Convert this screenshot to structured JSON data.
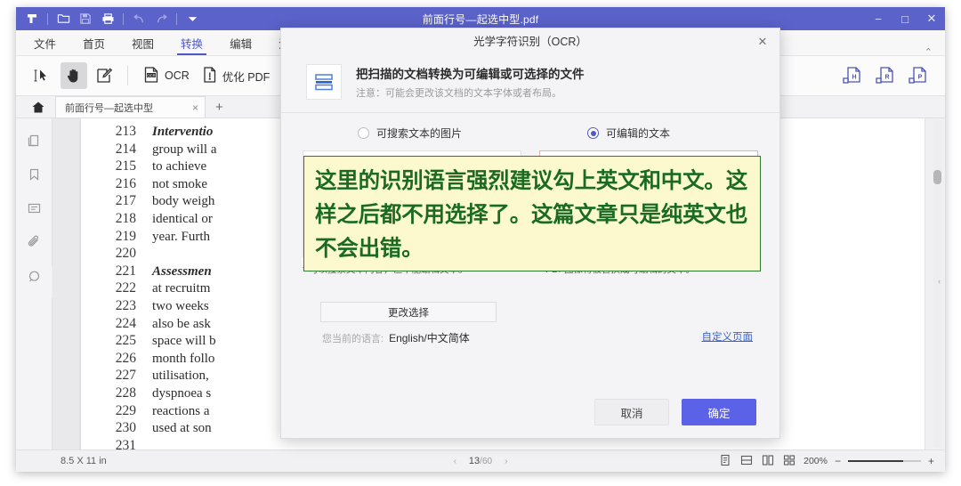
{
  "window": {
    "title": "前面行号—起选中型.pdf",
    "quick_access": [
      {
        "name": "app-logo-icon",
        "label": "F"
      },
      {
        "name": "open-file-icon",
        "label": "open"
      },
      {
        "name": "save-icon",
        "label": "save"
      },
      {
        "name": "print-icon",
        "label": "print"
      },
      {
        "name": "undo-icon",
        "label": "undo"
      },
      {
        "name": "redo-icon",
        "label": "redo"
      },
      {
        "name": "customize-dropdown-icon",
        "label": "more"
      }
    ],
    "controls": {
      "minimize": "−",
      "maximize": "□",
      "close": "✕"
    }
  },
  "menubar": {
    "items": [
      {
        "label": "文件",
        "active": false
      },
      {
        "label": "首页",
        "active": false
      },
      {
        "label": "视图",
        "active": false
      },
      {
        "label": "转换",
        "active": true
      },
      {
        "label": "编辑",
        "active": false
      },
      {
        "label": "注释",
        "active": false
      }
    ]
  },
  "ribbon": {
    "tools": [
      {
        "name": "select-text-tool",
        "label": "",
        "icon": "text-cursor-icon",
        "selected": false
      },
      {
        "name": "hand-tool",
        "label": "",
        "icon": "hand-icon",
        "selected": true
      },
      {
        "name": "edit-tool",
        "label": "",
        "icon": "pencil-page-icon",
        "selected": false
      },
      {
        "name": "ocr-tool",
        "label": "OCR",
        "icon": "ocr-page-icon",
        "selected": false
      },
      {
        "name": "optimize-pdf-tool",
        "label": "优化 PDF",
        "icon": "optimize-page-icon",
        "selected": false
      },
      {
        "name": "to-word-tool",
        "label": "",
        "icon": "pdf-to-word-icon",
        "selected": false
      }
    ],
    "right_tools": [
      {
        "name": "to-html-tool",
        "icon": "pdf-to-html-icon",
        "label": "H"
      },
      {
        "name": "to-rtf-tool",
        "icon": "pdf-to-rtf-icon",
        "label": "R"
      },
      {
        "name": "to-ppt-tool",
        "icon": "pdf-to-ppt-icon",
        "label": "P"
      }
    ],
    "collapse_label": "⌃"
  },
  "tabstrip": {
    "home_icon": "home-icon",
    "tab_label": "前面行号—起选中型",
    "close_label": "×",
    "add_label": "+"
  },
  "left_rail": {
    "items": [
      {
        "name": "page-thumbnails-icon",
        "label": "thumbnails"
      },
      {
        "name": "bookmark-icon",
        "label": "bookmarks"
      },
      {
        "name": "comment-list-icon",
        "label": "comments"
      },
      {
        "name": "attachment-icon",
        "label": "attachments"
      },
      {
        "name": "stamp-icon",
        "label": "stamps"
      }
    ],
    "expander_label": "›"
  },
  "document": {
    "lines": [
      {
        "no": "213",
        "text": "Interventio",
        "bold": true
      },
      {
        "no": "214",
        "text": "group will a",
        "bold": false
      },
      {
        "no": "215",
        "text": "to achieve ",
        "bold": false
      },
      {
        "no": "216",
        "text": "not smoke",
        "bold": false
      },
      {
        "no": "217",
        "text": "body weigh",
        "bold": false
      },
      {
        "no": "218",
        "text": "identical or",
        "bold": false
      },
      {
        "no": "219",
        "text": "year. Furth",
        "bold": false
      },
      {
        "no": "220",
        "text": "",
        "bold": false
      },
      {
        "no": "221",
        "text": "Assessmen",
        "bold": true
      },
      {
        "no": "222",
        "text": "at recruitm",
        "bold": false
      },
      {
        "no": "223",
        "text": "two weeks",
        "bold": false
      },
      {
        "no": "224",
        "text": "also be ask",
        "bold": false
      },
      {
        "no": "225",
        "text": "space will b",
        "bold": false
      },
      {
        "no": "226",
        "text": "month follo",
        "bold": false
      },
      {
        "no": "227",
        "text": "utilisation,",
        "bold": false
      },
      {
        "no": "228",
        "text": "dyspnoea s",
        "bold": false
      },
      {
        "no": "229",
        "text": "reactions a",
        "bold": false
      },
      {
        "no": "230",
        "text": "used at son",
        "bold": false
      },
      {
        "no": "231",
        "text": "",
        "bold": false
      }
    ]
  },
  "statusbar": {
    "page_size": "8.5 X 11 in",
    "prev_label": "‹",
    "next_label": "›",
    "current_page": "13",
    "total_pages": "/60",
    "view_modes": [
      {
        "name": "single-page-view-icon",
        "label": "single"
      },
      {
        "name": "continuous-view-icon",
        "label": "continuous"
      },
      {
        "name": "two-page-view-icon",
        "label": "facing"
      },
      {
        "name": "thumbnail-grid-view-icon",
        "label": "grid"
      }
    ],
    "zoom_percent": "200%",
    "zoom_out_label": "−",
    "zoom_in_label": "+"
  },
  "dialog": {
    "title": "光学字符识别（OCR）",
    "close_label": "✕",
    "header_icon": "scan-document-icon",
    "header_title": "把扫描的文档转换为可编辑或可选择的文件",
    "header_note": "注意：可能会更改该文档的文本字体或者布局。",
    "options": [
      {
        "name": "searchable-image-option",
        "label": "可搜索文本的图片",
        "checked": false,
        "caption": "* 可以搜索文本内容，但不能编辑文本。"
      },
      {
        "name": "editable-text-option",
        "label": "可编辑的文本",
        "checked": true,
        "caption": "* PDF图像将被替换成可编辑的文本。"
      }
    ],
    "change_selection_label": "更改选择",
    "current_language_label": "您当前的语言:",
    "current_language_value": "English/中文简体",
    "custom_pages_link": "自定义页面",
    "cancel_label": "取消",
    "ok_label": "确定"
  },
  "annotation": {
    "lines": [
      "这里的识别语言强烈建议勾上英文和中文。这",
      "样之后都不用选择了。这篇文章只是纯英文也",
      "不会出错。"
    ],
    "text_color": "#1a6b21",
    "bg_color": "#fbf9cd",
    "border_color": "#2f7a33",
    "highlight_box_color": "#e81b1b"
  },
  "theme": {
    "titlebar_color": "#5b62c9",
    "accent_color": "#4f58c4",
    "ok_button_color": "#5b62e8"
  }
}
